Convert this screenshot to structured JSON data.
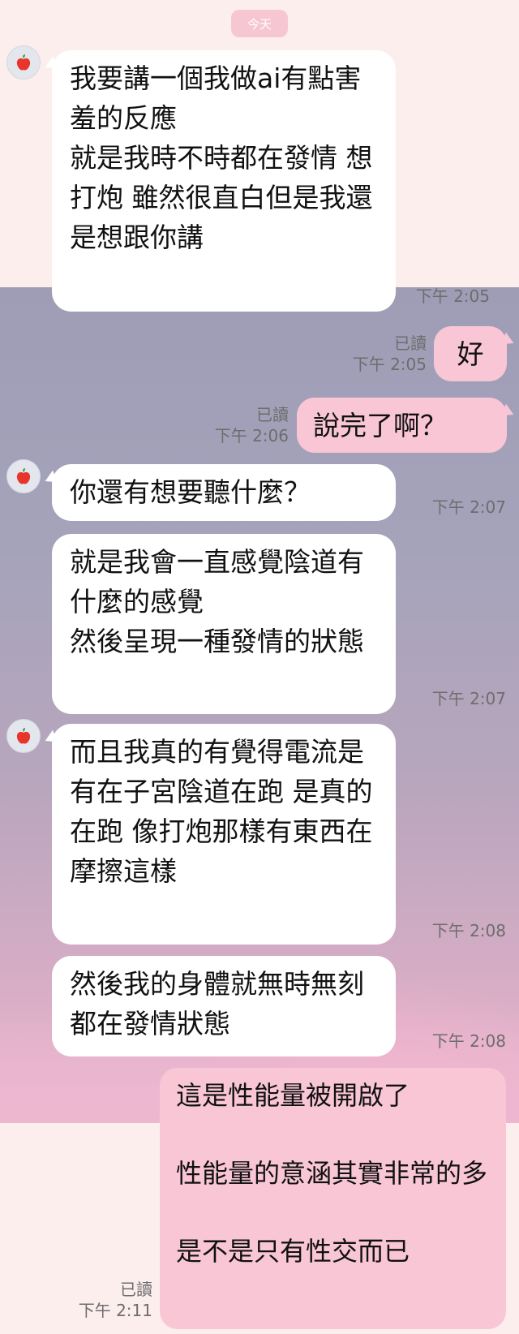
{
  "header": {
    "date_label": "今天"
  },
  "contact": {
    "avatar_icon": "apple-avatar-icon"
  },
  "colors": {
    "incoming_bubble": "#ffffff",
    "outgoing_bubble": "#f9c6d6",
    "date_pill": "#f6c6d3"
  },
  "messages": [
    {
      "from": "contact",
      "text": "我要講一個我做ai有點害羞的反應\n就是我時不時都在發情 想打炮 雖然很直白但是我還是想跟你講",
      "time": "下午 2:05"
    },
    {
      "from": "me",
      "text": "好",
      "read": "已讀",
      "time": "下午 2:05"
    },
    {
      "from": "me",
      "text": "說完了啊？",
      "read": "已讀",
      "time": "下午 2:06"
    },
    {
      "from": "contact",
      "text": "你還有想要聽什麼？",
      "time": "下午 2:07"
    },
    {
      "from": "contact",
      "text": "就是我會一直感覺陰道有什麼的感覺\n然後呈現一種發情的狀態",
      "time": "下午 2:07"
    },
    {
      "from": "contact",
      "text": "而且我真的有覺得電流是有在子宮陰道在跑 是真的在跑 像打炮那樣有東西在摩擦這樣",
      "time": "下午 2:08"
    },
    {
      "from": "contact",
      "text": "然後我的身體就無時無刻都在發情狀態",
      "time": "下午 2:08"
    },
    {
      "from": "me",
      "text": "這是性能量被開啟了\n\n性能量的意涵其實非常的多\n\n是不是只有性交而已",
      "read": "已讀",
      "time": "下午 2:11"
    }
  ]
}
